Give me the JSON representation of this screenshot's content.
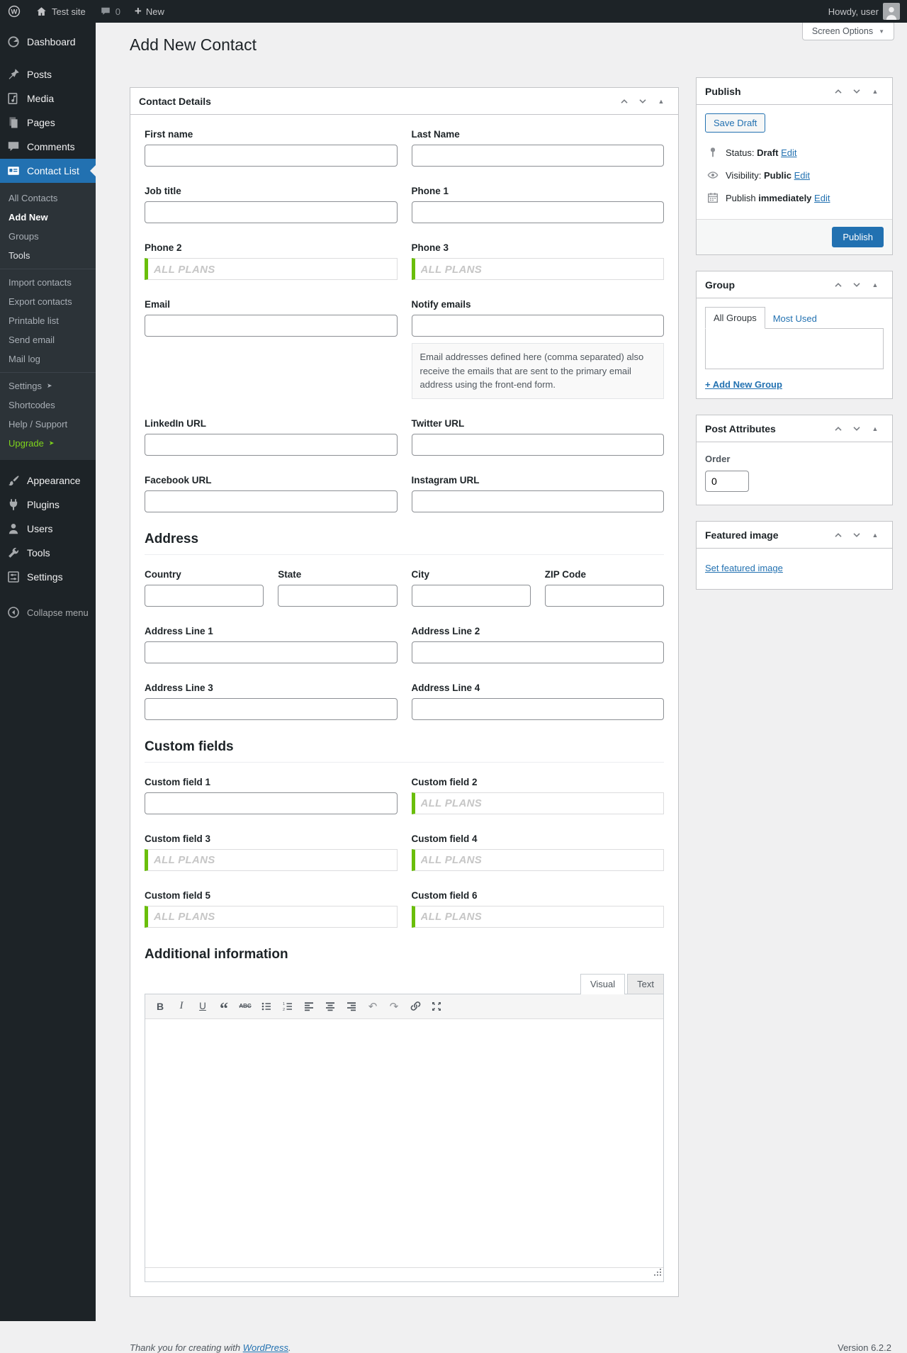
{
  "admin_bar": {
    "site_name": "Test site",
    "comments_count": "0",
    "new_label": "New",
    "howdy": "Howdy, user"
  },
  "sidebar": {
    "main": [
      "Dashboard",
      "Posts",
      "Media",
      "Pages",
      "Comments",
      "Contact List",
      "Appearance",
      "Plugins",
      "Users",
      "Tools",
      "Settings"
    ],
    "submenu": [
      "All Contacts",
      "Add New",
      "Groups",
      "Tools",
      "Import contacts",
      "Export contacts",
      "Printable list",
      "Send email",
      "Mail log",
      "Settings",
      "Shortcodes",
      "Help / Support",
      "Upgrade"
    ],
    "submenu_arrow": "➤",
    "collapse": "Collapse menu"
  },
  "page": {
    "title": "Add New Contact",
    "screen_options": "Screen Options"
  },
  "contact_details": {
    "title": "Contact Details",
    "labels": {
      "first_name": "First name",
      "last_name": "Last Name",
      "job_title": "Job title",
      "phone1": "Phone 1",
      "phone2": "Phone 2",
      "phone3": "Phone 3",
      "email": "Email",
      "notify_emails": "Notify emails",
      "linkedin": "LinkedIn URL",
      "twitter": "Twitter URL",
      "facebook": "Facebook URL",
      "instagram": "Instagram URL",
      "country": "Country",
      "state": "State",
      "city": "City",
      "zip": "ZIP Code",
      "address1": "Address Line 1",
      "address2": "Address Line 2",
      "address3": "Address Line 3",
      "address4": "Address Line 4",
      "custom1": "Custom field 1",
      "custom2": "Custom field 2",
      "custom3": "Custom field 3",
      "custom4": "Custom field 4",
      "custom5": "Custom field 5",
      "custom6": "Custom field 6"
    },
    "all_plans": "ALL PLANS",
    "notify_help": "Email addresses defined here (comma separated) also receive the emails that are sent to the primary email address using the front-end form.",
    "sections": {
      "address": "Address",
      "custom_fields": "Custom fields",
      "additional_info": "Additional information"
    }
  },
  "editor": {
    "tabs": [
      "Visual",
      "Text"
    ],
    "glyphs": {
      "bold": "B",
      "italic": "I",
      "underline": "U",
      "quote": "“",
      "strike": "ABC",
      "undo": "↶",
      "redo": "↷"
    }
  },
  "publish_box": {
    "title": "Publish",
    "save_draft": "Save Draft",
    "status_label": "Status:",
    "status_value": "Draft",
    "visibility_label": "Visibility:",
    "visibility_value": "Public",
    "schedule_label": "Publish",
    "schedule_value": "immediately",
    "edit_label": "Edit",
    "publish_button": "Publish"
  },
  "group_box": {
    "title": "Group",
    "tab_all": "All Groups",
    "tab_most_used": "Most Used",
    "add_new": "+ Add New Group"
  },
  "post_attributes": {
    "title": "Post Attributes",
    "order_label": "Order",
    "order_value": "0"
  },
  "featured_image": {
    "title": "Featured image",
    "set_link": "Set featured image"
  },
  "footer": {
    "thanks_prefix": "Thank you for creating with ",
    "wordpress_link": "WordPress",
    "thanks_suffix": ".",
    "version": "Version 6.2.2"
  },
  "colors": {
    "accent": "#2271b1",
    "admin_dark": "#1d2327",
    "submenu_dark": "#2c3338",
    "upgrade_green": "#7fd41c",
    "locked_green": "#6abe0a"
  }
}
